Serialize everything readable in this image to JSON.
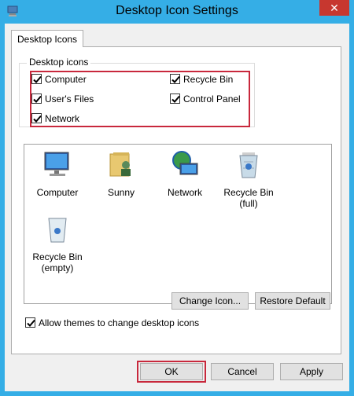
{
  "window": {
    "title": "Desktop Icon Settings",
    "close_glyph": "✕"
  },
  "tabs": [
    {
      "label": "Desktop Icons"
    }
  ],
  "desktop_icons_group": {
    "label": "Desktop icons",
    "checkboxes": [
      {
        "label": "Computer",
        "checked": true
      },
      {
        "label": "Recycle Bin",
        "checked": true
      },
      {
        "label": "User's Files",
        "checked": true
      },
      {
        "label": "Control Panel",
        "checked": true
      },
      {
        "label": "Network",
        "checked": true
      }
    ]
  },
  "icons": [
    {
      "label": "Computer",
      "icon": "computer-icon"
    },
    {
      "label": "Sunny",
      "icon": "user-folder-icon"
    },
    {
      "label": "Network",
      "icon": "network-icon"
    },
    {
      "label": "Recycle Bin\n(full)",
      "icon": "recycle-bin-full-icon"
    },
    {
      "label": "Recycle Bin\n(empty)",
      "icon": "recycle-bin-empty-icon"
    }
  ],
  "buttons": {
    "change_icon": "Change Icon...",
    "restore_default": "Restore Default",
    "ok": "OK",
    "cancel": "Cancel",
    "apply": "Apply"
  },
  "themes_checkbox": {
    "label": "Allow themes to change desktop icons",
    "checked": true
  },
  "colors": {
    "accent_frame": "#35aee6",
    "highlight_red": "#c8283c",
    "close_red": "#c7372f"
  }
}
